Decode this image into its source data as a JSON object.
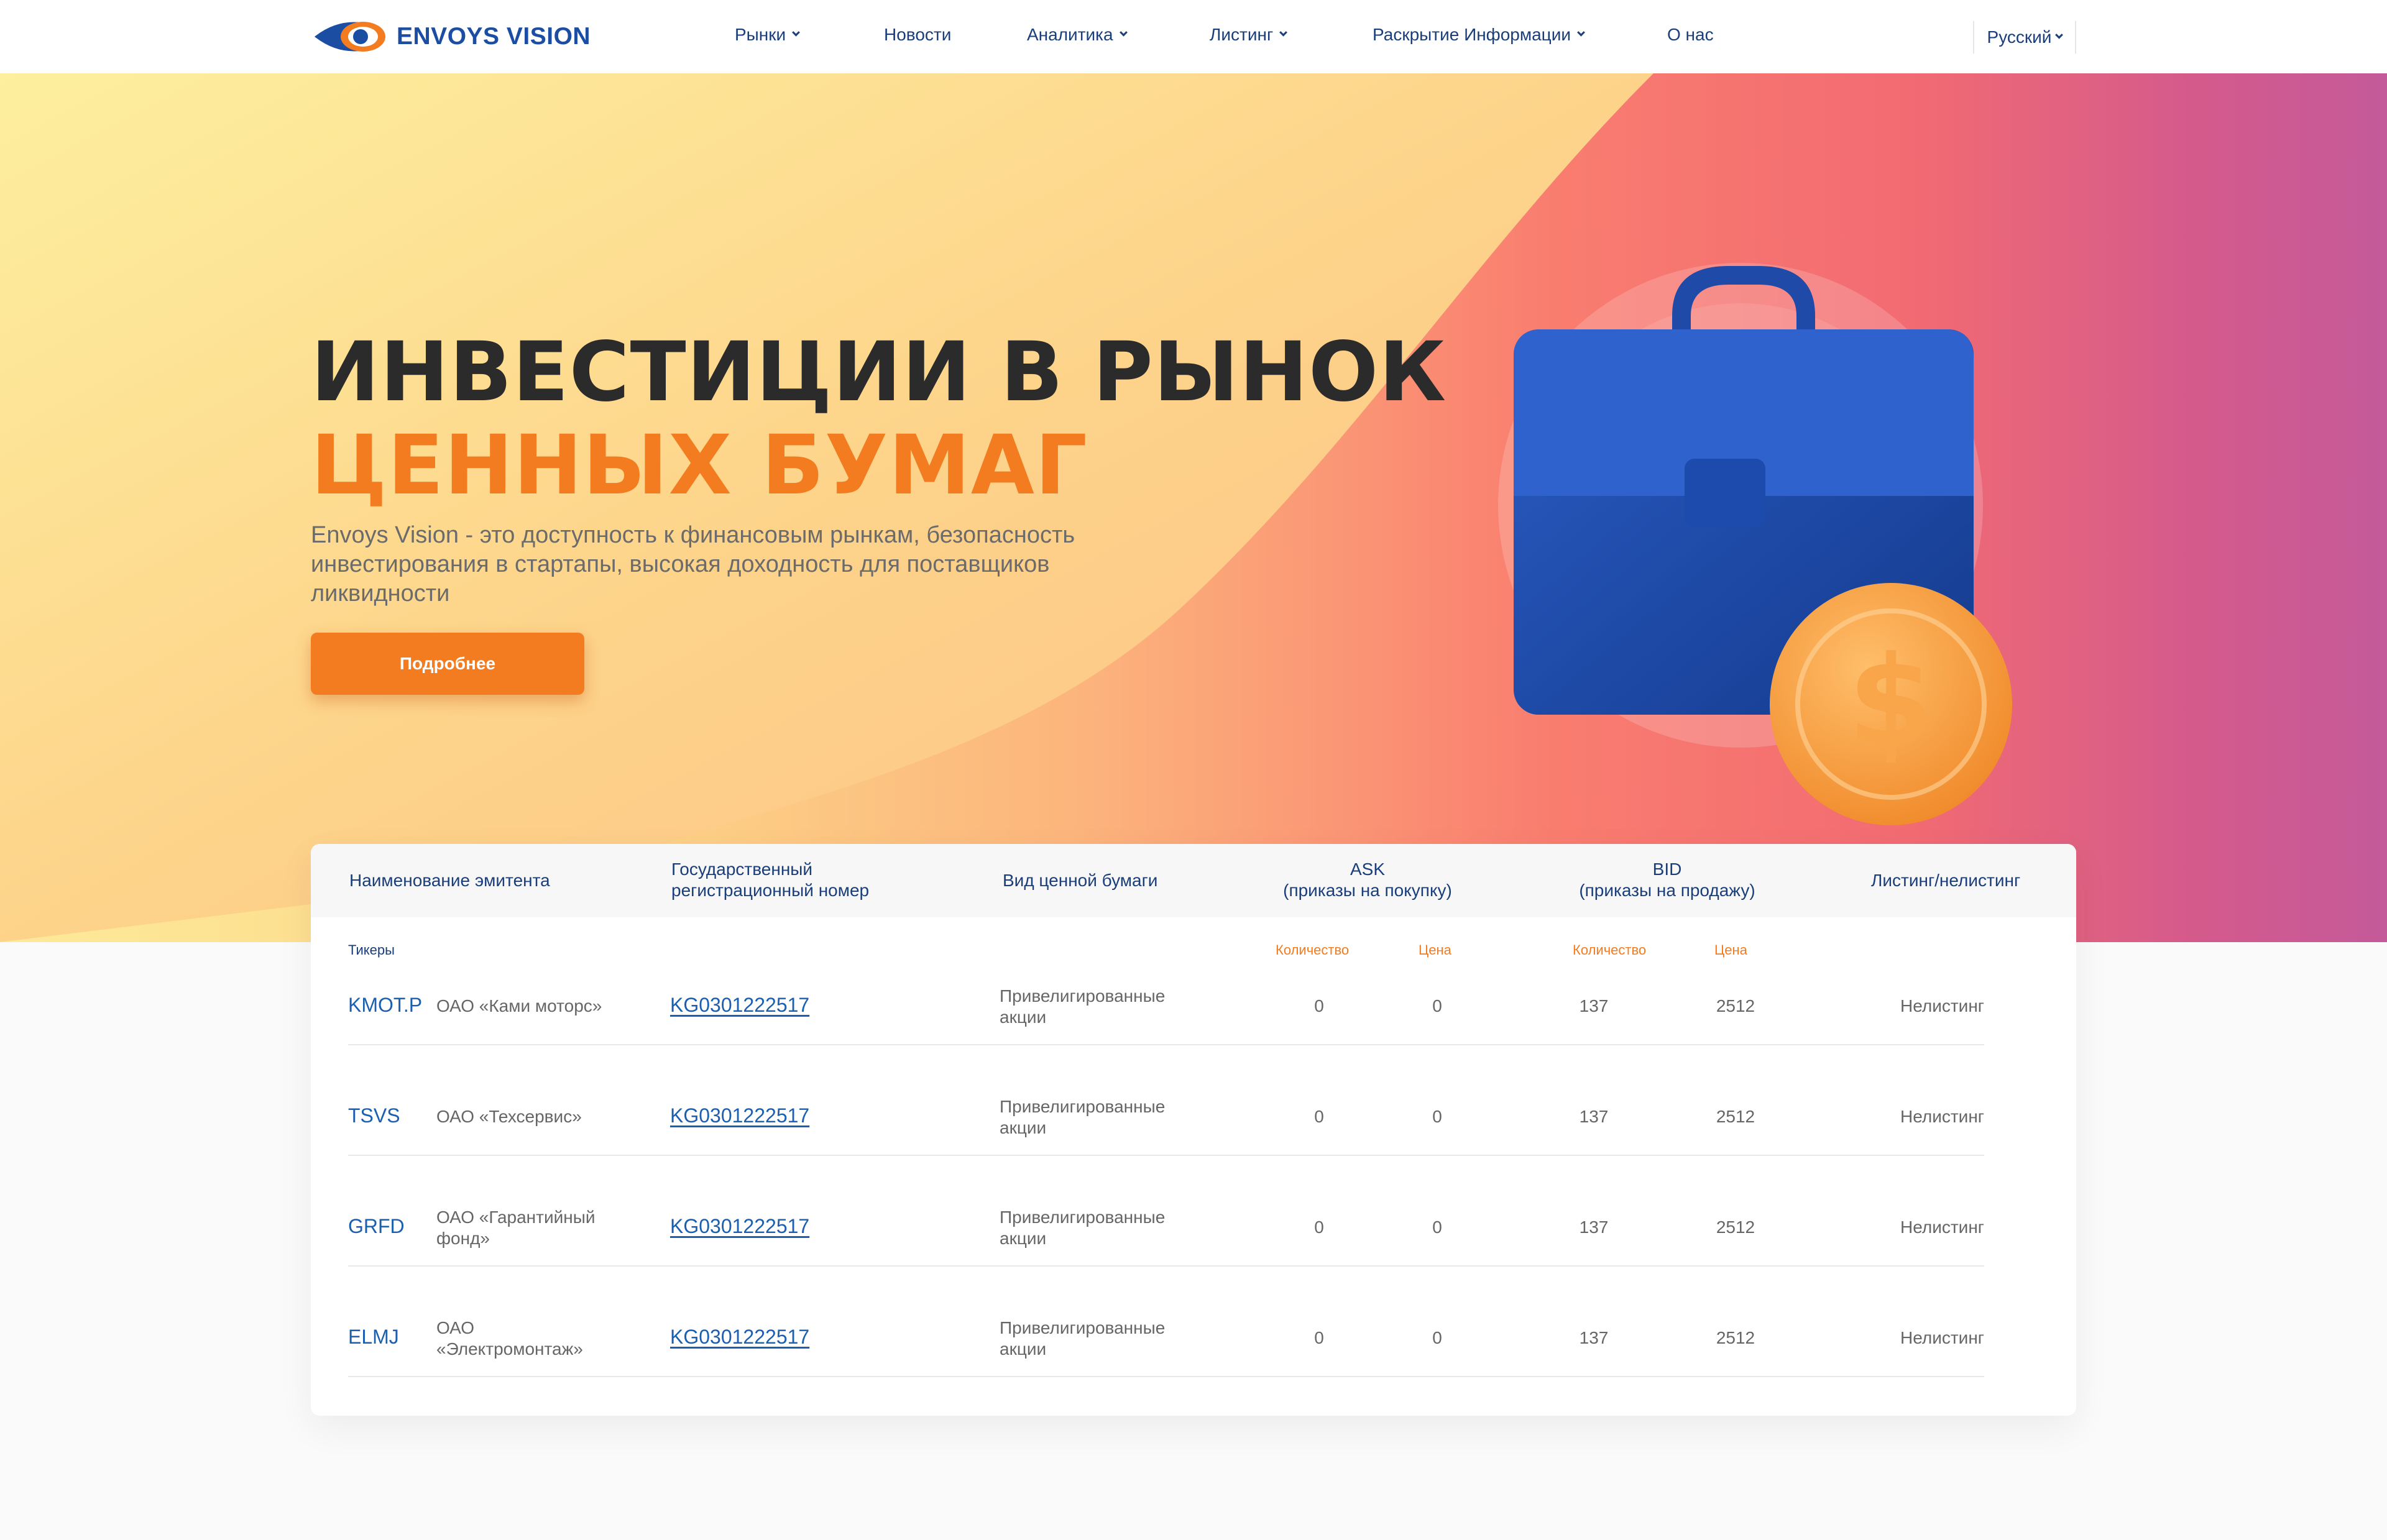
{
  "brand": {
    "name": "ENVOYS VISION",
    "accent": "#f47c20",
    "primary": "#1b4ea3"
  },
  "nav": {
    "items": [
      {
        "label": "Рынки",
        "dropdown": true
      },
      {
        "label": "Новости",
        "dropdown": false
      },
      {
        "label": "Аналитика",
        "dropdown": true
      },
      {
        "label": "Листинг",
        "dropdown": true
      },
      {
        "label": "Раскрытие Информации",
        "dropdown": true
      },
      {
        "label": "О нас",
        "dropdown": false
      }
    ],
    "language": "Русский"
  },
  "hero": {
    "title_line1": "ИНВЕСТИЦИИ В РЫНОК",
    "title_line2": "ЦЕННЫХ БУМАГ",
    "description": "Envoys Vision - это доступность к финансовым рынкам, безопасность инвестирования в стартапы, высокая доходность для поставщиков ликвидности",
    "button": "Подробнее"
  },
  "table": {
    "headers": {
      "issuer": "Наименование эмитента",
      "reg_line1": "Государственный",
      "reg_line2": "регистрационный номер",
      "type": "Вид ценной бумаги",
      "ask_line1": "ASK",
      "ask_line2": "(приказы на покупку)",
      "bid_line1": "BID",
      "bid_line2": "(приказы на продажу)",
      "listing": "Листинг/нелистинг"
    },
    "subheaders": {
      "tickers": "Тикеры",
      "ask_qty": "Количество",
      "ask_price": "Цена",
      "bid_qty": "Количество",
      "bid_price": "Цена"
    },
    "rows": [
      {
        "ticker": "KMOT.P",
        "issuer": "ОАО «Ками моторс»",
        "reg": "KG0301222517",
        "type": "Привелигированные акции",
        "ask_qty": "0",
        "ask_price": "0",
        "bid_qty": "137",
        "bid_price": "2512",
        "status": "Нелистинг"
      },
      {
        "ticker": "TSVS",
        "issuer": "ОАО «Техсервис»",
        "reg": "KG0301222517",
        "type": "Привелигированные акции",
        "ask_qty": "0",
        "ask_price": "0",
        "bid_qty": "137",
        "bid_price": "2512",
        "status": "Нелистинг"
      },
      {
        "ticker": "GRFD",
        "issuer": "ОАО «Гарантийный фонд»",
        "reg": "KG0301222517",
        "type": "Привелигированные акции",
        "ask_qty": "0",
        "ask_price": "0",
        "bid_qty": "137",
        "bid_price": "2512",
        "status": "Нелистинг"
      },
      {
        "ticker": "ELMJ",
        "issuer": "ОАО «Электромонтаж»",
        "reg": "KG0301222517",
        "type": "Привелигированные акции",
        "ask_qty": "0",
        "ask_price": "0",
        "bid_qty": "137",
        "bid_price": "2512",
        "status": "Нелистинг"
      }
    ]
  }
}
